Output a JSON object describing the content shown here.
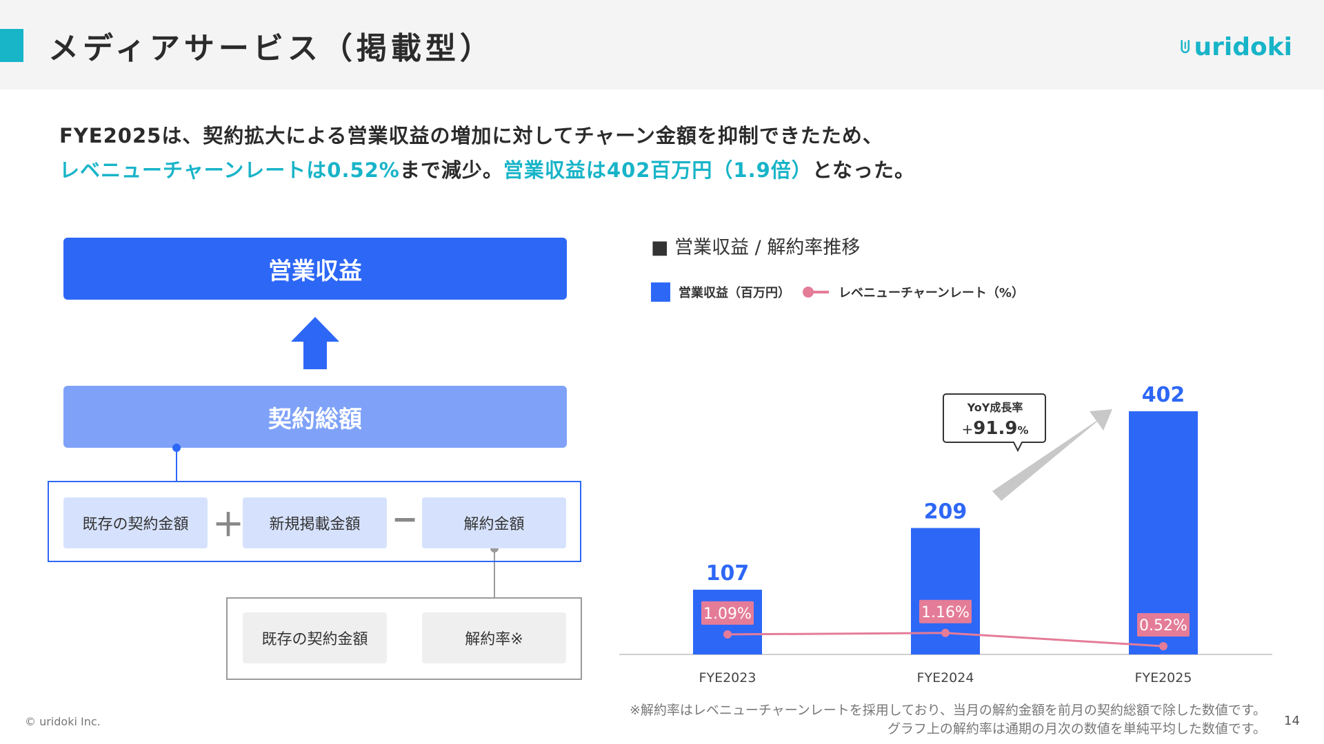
{
  "header": {
    "title": "メディアサービス（掲載型）",
    "logo_text": "uridoki"
  },
  "headline": {
    "line1": "FYE2025は、契約拡大による営業収益の増加に対してチャーン金額を抑制できたため、",
    "line2_part1": "レベニューチャーンレートは0.52%",
    "line2_part2": "まで減少。",
    "line2_part3": "営業収益は402百万円（1.9倍）",
    "line2_part4": "となった。"
  },
  "diagram": {
    "revenue": "営業収益",
    "total": "契約総額",
    "existing_contract": "既存の契約金額",
    "plus": "＋",
    "new_listing": "新規掲載金額",
    "minus": "−",
    "cancel_amount": "解約金額",
    "existing_contract_2": "既存の契約金額",
    "cancel_rate": "解約率※"
  },
  "chart_data": {
    "type": "bar",
    "title": "■ 営業収益 / 解約率推移",
    "categories": [
      "FYE2023",
      "FYE2024",
      "FYE2025"
    ],
    "series": [
      {
        "name": "営業収益（百万円）",
        "values": [
          107,
          209,
          402
        ],
        "color": "#2d67f6"
      },
      {
        "name": "レベニューチャーンレート（%）",
        "values": [
          1.09,
          1.16,
          0.52
        ],
        "labels": [
          "1.09%",
          "1.16%",
          "0.52%"
        ],
        "color": "#e47c98"
      }
    ],
    "ylim": [
      0,
      402
    ],
    "callout": {
      "label": "YoY成長率",
      "prefix": "+",
      "value": "91.9",
      "unit": "%"
    }
  },
  "legend": {
    "bar": "営業収益（百万円）",
    "line": "レベニューチャーンレート（%）"
  },
  "footnote": {
    "line1": "※解約率はレベニューチャーンレートを採用しており、当月の解約金額を前月の契約総額で除した数値です。",
    "line2": "グラフ上の解約率は通期の月次の数値を単純平均した数値です。"
  },
  "copyright": "© uridoki Inc.",
  "page_number": "14",
  "colors": {
    "accent": "#18b4c8",
    "blue": "#2d67f6",
    "light_blue": "#7fa2f8",
    "pink": "#e47c98"
  }
}
